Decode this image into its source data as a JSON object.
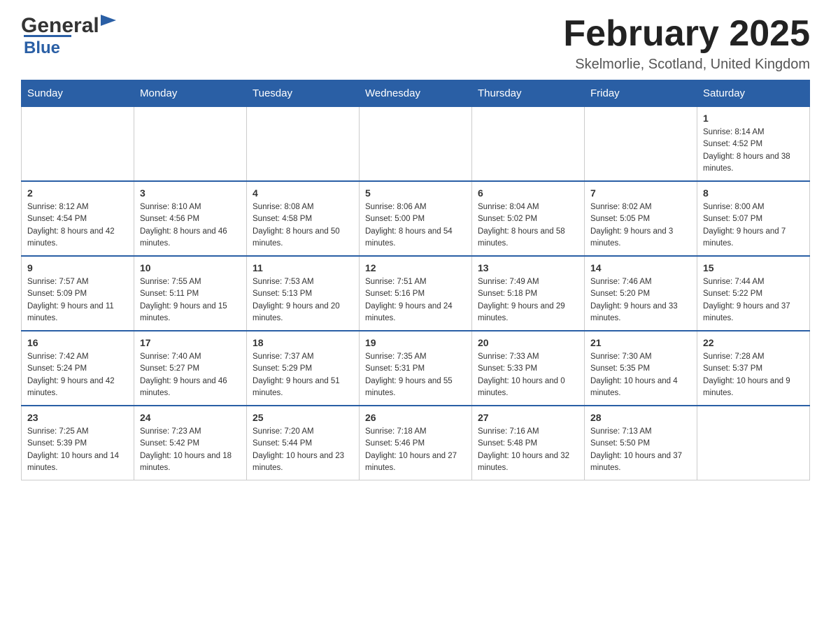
{
  "header": {
    "logo_general": "General",
    "logo_blue": "Blue",
    "month_title": "February 2025",
    "location": "Skelmorlie, Scotland, United Kingdom"
  },
  "weekdays": [
    "Sunday",
    "Monday",
    "Tuesday",
    "Wednesday",
    "Thursday",
    "Friday",
    "Saturday"
  ],
  "weeks": [
    [
      {
        "day": "",
        "info": ""
      },
      {
        "day": "",
        "info": ""
      },
      {
        "day": "",
        "info": ""
      },
      {
        "day": "",
        "info": ""
      },
      {
        "day": "",
        "info": ""
      },
      {
        "day": "",
        "info": ""
      },
      {
        "day": "1",
        "info": "Sunrise: 8:14 AM\nSunset: 4:52 PM\nDaylight: 8 hours and 38 minutes."
      }
    ],
    [
      {
        "day": "2",
        "info": "Sunrise: 8:12 AM\nSunset: 4:54 PM\nDaylight: 8 hours and 42 minutes."
      },
      {
        "day": "3",
        "info": "Sunrise: 8:10 AM\nSunset: 4:56 PM\nDaylight: 8 hours and 46 minutes."
      },
      {
        "day": "4",
        "info": "Sunrise: 8:08 AM\nSunset: 4:58 PM\nDaylight: 8 hours and 50 minutes."
      },
      {
        "day": "5",
        "info": "Sunrise: 8:06 AM\nSunset: 5:00 PM\nDaylight: 8 hours and 54 minutes."
      },
      {
        "day": "6",
        "info": "Sunrise: 8:04 AM\nSunset: 5:02 PM\nDaylight: 8 hours and 58 minutes."
      },
      {
        "day": "7",
        "info": "Sunrise: 8:02 AM\nSunset: 5:05 PM\nDaylight: 9 hours and 3 minutes."
      },
      {
        "day": "8",
        "info": "Sunrise: 8:00 AM\nSunset: 5:07 PM\nDaylight: 9 hours and 7 minutes."
      }
    ],
    [
      {
        "day": "9",
        "info": "Sunrise: 7:57 AM\nSunset: 5:09 PM\nDaylight: 9 hours and 11 minutes."
      },
      {
        "day": "10",
        "info": "Sunrise: 7:55 AM\nSunset: 5:11 PM\nDaylight: 9 hours and 15 minutes."
      },
      {
        "day": "11",
        "info": "Sunrise: 7:53 AM\nSunset: 5:13 PM\nDaylight: 9 hours and 20 minutes."
      },
      {
        "day": "12",
        "info": "Sunrise: 7:51 AM\nSunset: 5:16 PM\nDaylight: 9 hours and 24 minutes."
      },
      {
        "day": "13",
        "info": "Sunrise: 7:49 AM\nSunset: 5:18 PM\nDaylight: 9 hours and 29 minutes."
      },
      {
        "day": "14",
        "info": "Sunrise: 7:46 AM\nSunset: 5:20 PM\nDaylight: 9 hours and 33 minutes."
      },
      {
        "day": "15",
        "info": "Sunrise: 7:44 AM\nSunset: 5:22 PM\nDaylight: 9 hours and 37 minutes."
      }
    ],
    [
      {
        "day": "16",
        "info": "Sunrise: 7:42 AM\nSunset: 5:24 PM\nDaylight: 9 hours and 42 minutes."
      },
      {
        "day": "17",
        "info": "Sunrise: 7:40 AM\nSunset: 5:27 PM\nDaylight: 9 hours and 46 minutes."
      },
      {
        "day": "18",
        "info": "Sunrise: 7:37 AM\nSunset: 5:29 PM\nDaylight: 9 hours and 51 minutes."
      },
      {
        "day": "19",
        "info": "Sunrise: 7:35 AM\nSunset: 5:31 PM\nDaylight: 9 hours and 55 minutes."
      },
      {
        "day": "20",
        "info": "Sunrise: 7:33 AM\nSunset: 5:33 PM\nDaylight: 10 hours and 0 minutes."
      },
      {
        "day": "21",
        "info": "Sunrise: 7:30 AM\nSunset: 5:35 PM\nDaylight: 10 hours and 4 minutes."
      },
      {
        "day": "22",
        "info": "Sunrise: 7:28 AM\nSunset: 5:37 PM\nDaylight: 10 hours and 9 minutes."
      }
    ],
    [
      {
        "day": "23",
        "info": "Sunrise: 7:25 AM\nSunset: 5:39 PM\nDaylight: 10 hours and 14 minutes."
      },
      {
        "day": "24",
        "info": "Sunrise: 7:23 AM\nSunset: 5:42 PM\nDaylight: 10 hours and 18 minutes."
      },
      {
        "day": "25",
        "info": "Sunrise: 7:20 AM\nSunset: 5:44 PM\nDaylight: 10 hours and 23 minutes."
      },
      {
        "day": "26",
        "info": "Sunrise: 7:18 AM\nSunset: 5:46 PM\nDaylight: 10 hours and 27 minutes."
      },
      {
        "day": "27",
        "info": "Sunrise: 7:16 AM\nSunset: 5:48 PM\nDaylight: 10 hours and 32 minutes."
      },
      {
        "day": "28",
        "info": "Sunrise: 7:13 AM\nSunset: 5:50 PM\nDaylight: 10 hours and 37 minutes."
      },
      {
        "day": "",
        "info": ""
      }
    ]
  ]
}
